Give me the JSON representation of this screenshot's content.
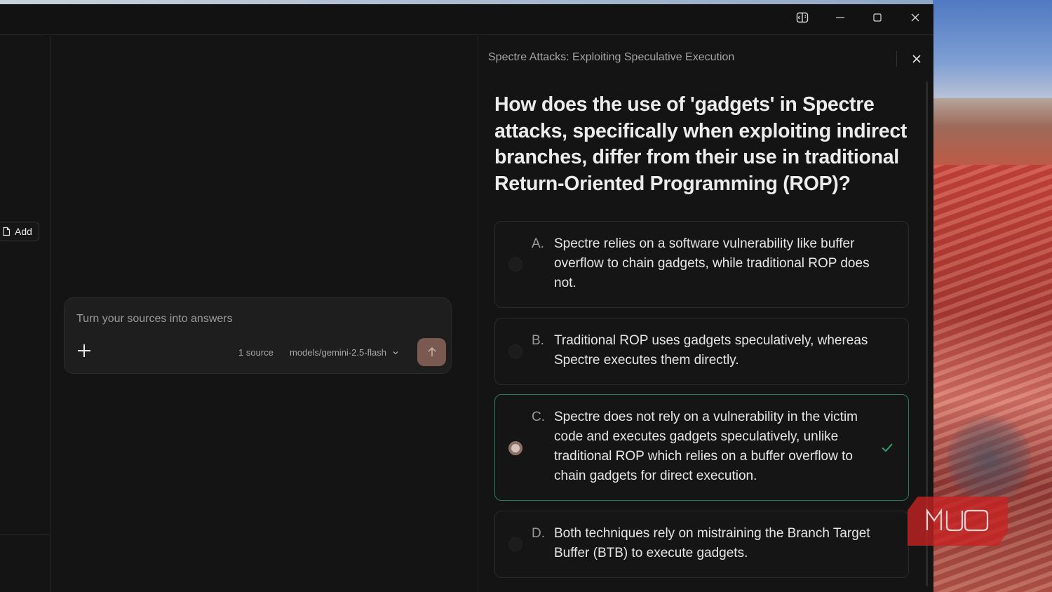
{
  "window": {
    "controls": [
      "sidebar-toggle-icon",
      "minimize-icon",
      "maximize-icon",
      "close-icon"
    ]
  },
  "sidebar": {
    "add_label": "Add"
  },
  "chat": {
    "input_placeholder": "Turn your sources into answers",
    "source_count": "1 source",
    "model": "models/gemini-2.5-flash"
  },
  "quiz": {
    "header": "Spectre Attacks: Exploiting Speculative Execution",
    "question": "How does the use of 'gadgets' in Spectre attacks, specifically when exploiting indirect branches, differ from their use in traditional Return-Oriented Programming (ROP)?",
    "options": [
      {
        "letter": "A.",
        "text": "Spectre relies on a software vulnerability like buffer overflow to chain gadgets, while traditional ROP does not.",
        "selected": false
      },
      {
        "letter": "B.",
        "text": "Traditional ROP uses gadgets speculatively, whereas Spectre executes them directly.",
        "selected": false
      },
      {
        "letter": "C.",
        "text": "Spectre does not rely on a vulnerability in the victim code and executes gadgets speculatively, unlike traditional ROP which relies on a buffer overflow to chain gadgets for direct execution.",
        "selected": true,
        "correct": true
      },
      {
        "letter": "D.",
        "text": "Both techniques rely on mistraining the Branch Target Buffer (BTB) to execute gadgets.",
        "selected": false
      }
    ]
  },
  "watermark": {
    "text": "MUO"
  },
  "colors": {
    "background": "#141414",
    "correct_border": "#2d7a5a",
    "check": "#2ea06a",
    "send_button": "#7a5a50"
  }
}
